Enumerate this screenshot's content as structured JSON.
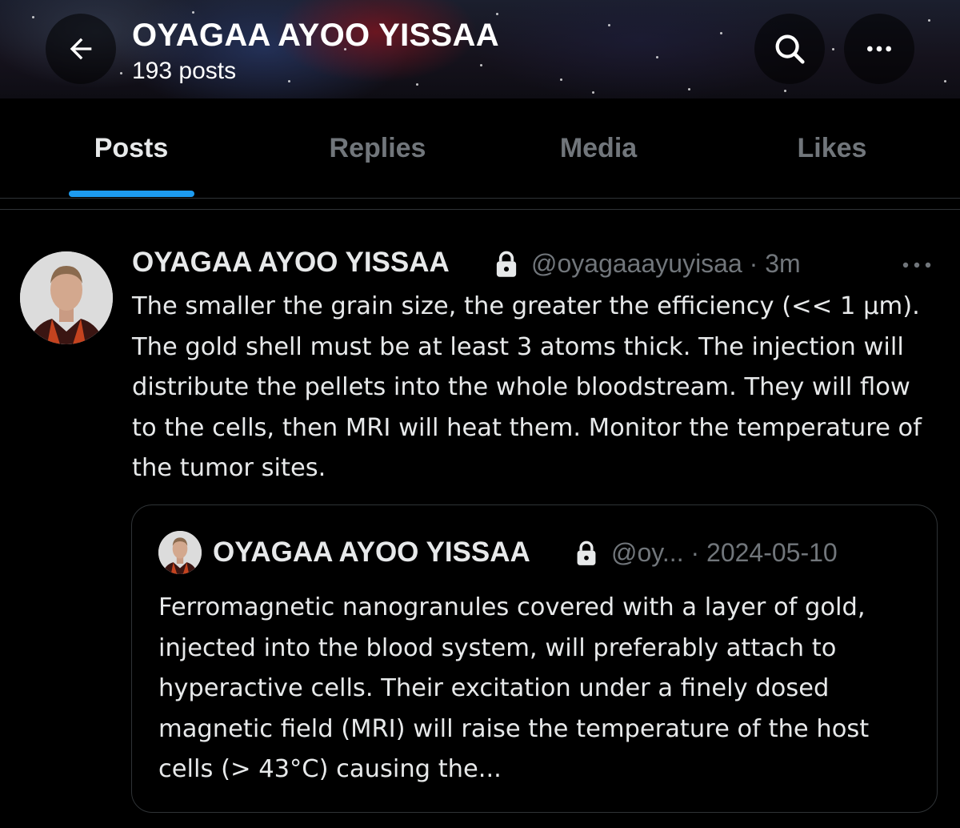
{
  "header": {
    "title": "OYAGAA AYOO YISSAA",
    "post_count": "193 posts",
    "icons": {
      "back": "arrow-left-icon",
      "search": "search-icon",
      "more": "more-horizontal-icon"
    }
  },
  "tabs": [
    {
      "label": "Posts",
      "active": true
    },
    {
      "label": "Replies",
      "active": false
    },
    {
      "label": "Media",
      "active": false
    },
    {
      "label": "Likes",
      "active": false
    }
  ],
  "post": {
    "author_name": "OYAGAA AYOO YISSAA",
    "handle_time": "@oyagaaayuyisaa · 3m",
    "text": "The smaller the grain size, the greater the efficiency (<< 1 µm). The gold shell must be at least 3 atoms thick. The injection will distribute the pellets into the whole bloodstream. They will flow to the cells, then MRI will heat them. Monitor the temperature of the tumor sites.",
    "quoted": {
      "author_name": "OYAGAA AYOO YISSAA",
      "handle_time": "@oy... · 2024-05-10",
      "text": "Ferromagnetic nanogranules covered with a layer of gold, injected into the blood system, will preferably attach to hyperactive cells. Their excitation under a finely dosed magnetic field (MRI) will raise the temperature of the host cells (> 43°C) causing the..."
    }
  },
  "colors": {
    "background": "#000000",
    "text_primary": "#e7e9ea",
    "text_secondary": "#71767b",
    "accent": "#1d9bf0",
    "border": "#2f3336"
  }
}
